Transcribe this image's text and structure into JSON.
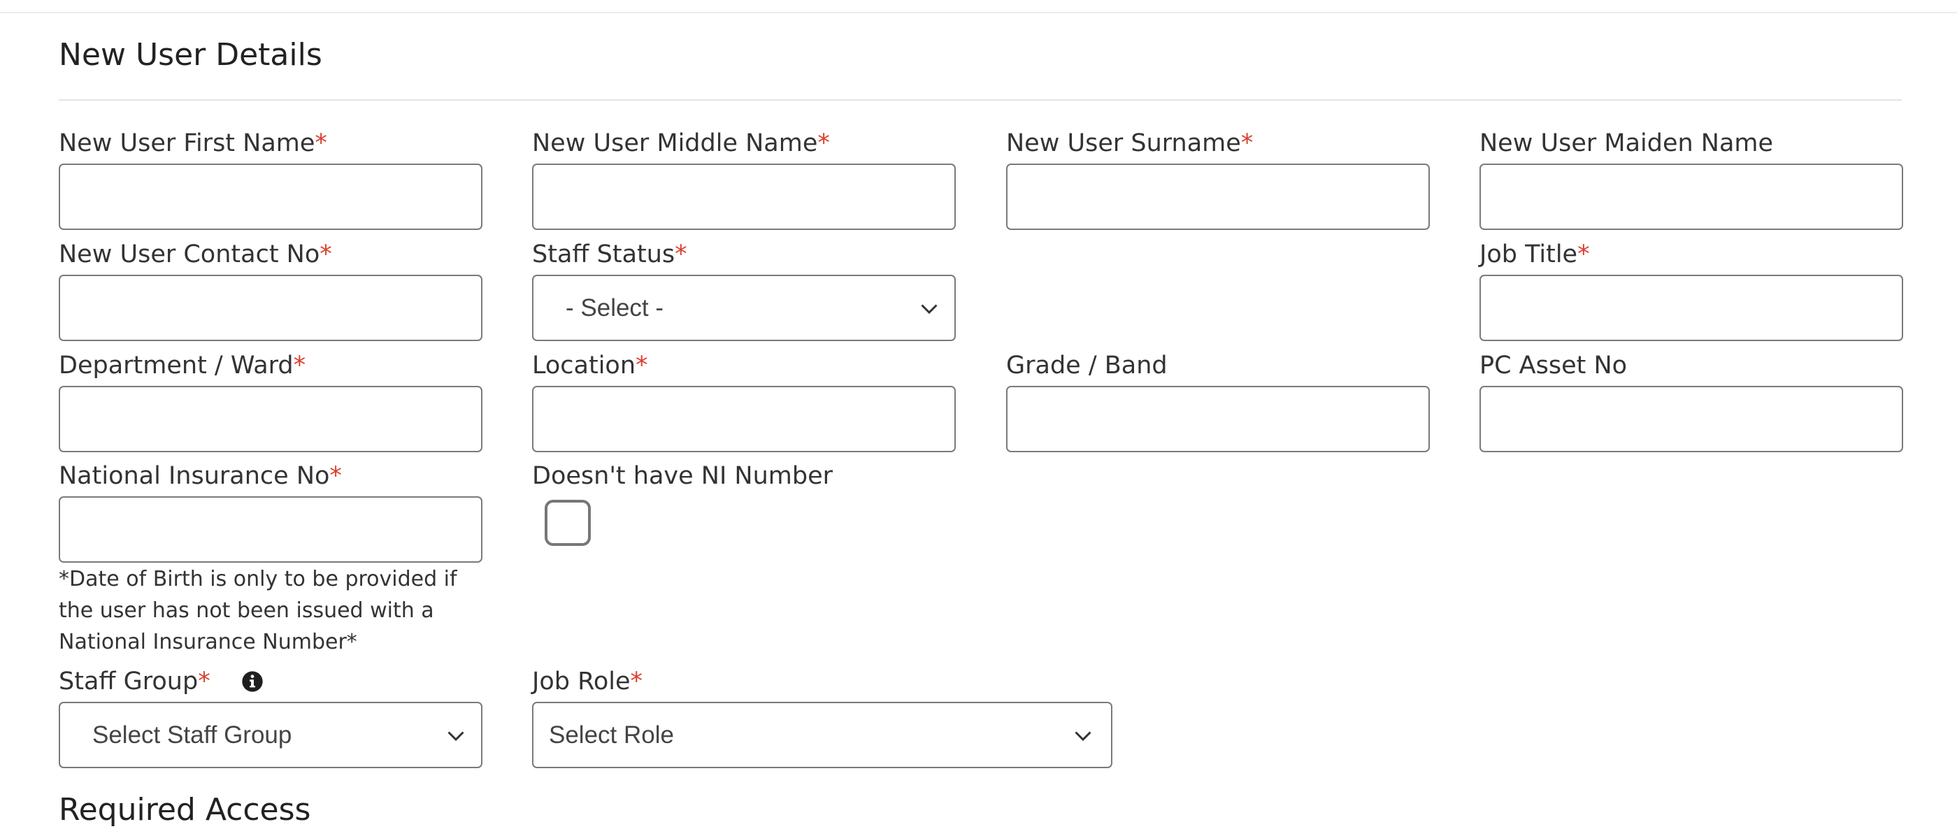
{
  "sections": {
    "new_user_details": "New User Details",
    "required_access": "Required Access"
  },
  "required_marker": "*",
  "fields": {
    "first_name": {
      "label": "New User First Name",
      "value": ""
    },
    "middle_name": {
      "label": "New User Middle Name",
      "value": ""
    },
    "surname": {
      "label": "New User Surname",
      "value": ""
    },
    "maiden_name": {
      "label": "New User Maiden Name",
      "value": ""
    },
    "contact_no": {
      "label": "New User Contact No",
      "value": ""
    },
    "staff_status": {
      "label": "Staff Status",
      "selected": "- Select -"
    },
    "job_title": {
      "label": "Job Title",
      "value": ""
    },
    "department": {
      "label": "Department / Ward",
      "value": ""
    },
    "location": {
      "label": "Location",
      "value": ""
    },
    "grade": {
      "label": "Grade / Band",
      "value": ""
    },
    "pc_asset": {
      "label": "PC Asset No",
      "value": ""
    },
    "ni_no": {
      "label": "National Insurance No",
      "value": ""
    },
    "no_ni": {
      "label": "Doesn't have NI Number",
      "checked": false
    },
    "staff_group": {
      "label": "Staff Group",
      "selected": "Select Staff Group",
      "info_icon": "info-circle-icon"
    },
    "job_role": {
      "label": "Job Role",
      "selected": "Select Role"
    }
  },
  "dob_note": "*Date of Birth is only to be provided if the user has not been issued with a National Insurance Number*",
  "colors": {
    "required": "#d9412f",
    "border": "#7a7a7a",
    "text": "#222222"
  }
}
